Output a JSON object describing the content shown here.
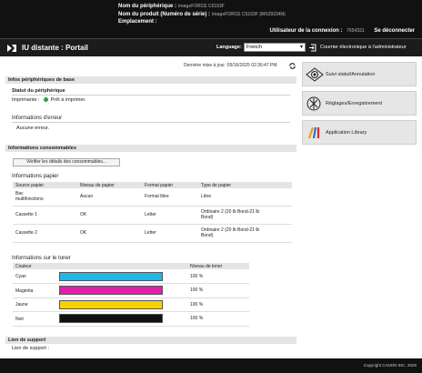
{
  "device_info": {
    "name_label": "Nom du périphérique :",
    "name_value": "imageFORCE C5153F",
    "product_label": "Nom du produit (Numéro de série) :",
    "product_value": "imageFORCE C5153F (MXZ9234N)",
    "location_label": "Emplacement :"
  },
  "user": {
    "label": "Utilisateur de la connexion :",
    "name": "7654321",
    "logout": "Se déconnecter"
  },
  "nav": {
    "title": "IU distante : Portail",
    "language_label": "Language:",
    "language_value": "French",
    "mail_link": "Courrier électronique à l'administrateur"
  },
  "main": {
    "last_updated": "Dernière mise à jour :05/16/2025 02:36:47 PM",
    "basic_info_title": "Infos périphériques de base",
    "device_status_title": "Statut du périphérique",
    "printer_label": "Imprimante :",
    "printer_status": "Prêt à imprimer.",
    "error_info_title": "Informations d'erreur",
    "error_value": "Aucune erreur.",
    "consumables_title": "Informations consommables",
    "check_button": "Vérifier les détails des consommables...",
    "paper_info_title": "Informations papier",
    "paper_headers": [
      "Source papier",
      "Niveau de papier",
      "Format papier",
      "Type de papier"
    ],
    "paper_rows": [
      {
        "source": "Bac multifonctions",
        "level": "Aucun",
        "size": "Format libre",
        "type": "Libre"
      },
      {
        "source": "Cassette 1",
        "level": "OK",
        "size": "Letter",
        "type": "Ordinaire 2 (20 lb Bond-21 lb Bond)"
      },
      {
        "source": "Cassette 2",
        "level": "OK",
        "size": "Letter",
        "type": "Ordinaire 2 (20 lb Bond-21 lb Bond)"
      }
    ],
    "toner_info_title": "Informations sur le toner",
    "toner_headers": [
      "Couleur",
      "Niveau de toner"
    ],
    "toner_rows": [
      {
        "name": "Cyan",
        "level": "100 %",
        "color": "#1fb6e8"
      },
      {
        "name": "Magenta",
        "level": "100 %",
        "color": "#e41ea8"
      },
      {
        "name": "Jaune",
        "level": "100 %",
        "color": "#f6d200"
      },
      {
        "name": "Noir",
        "level": "100 %",
        "color": "#111111"
      }
    ],
    "support_title": "Lien de support",
    "support_label": "Lien de support :"
  },
  "side": {
    "status_button": "Suivi statut/Annulation",
    "settings_button": "Réglages/Enregistrement",
    "library_button": "Application Library"
  },
  "footer": {
    "copyright": "Copyright CANON INC. 2025"
  }
}
